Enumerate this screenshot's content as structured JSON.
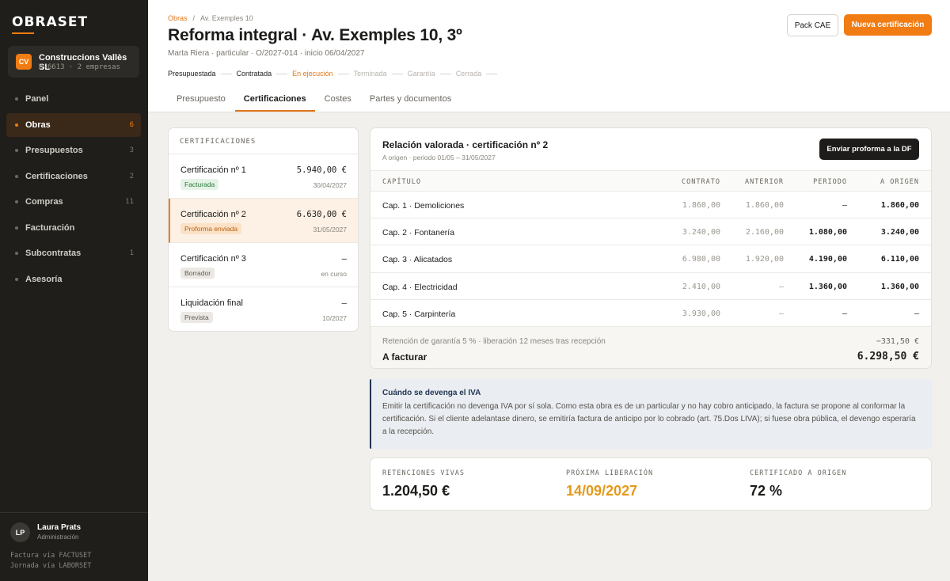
{
  "sidebar": {
    "logo": "OBRASET",
    "company": {
      "initials": "CV",
      "name": "Construccions Vallès SL",
      "sub": "B-6613 · 2 empresas"
    },
    "items": [
      {
        "label": "Panel",
        "count": ""
      },
      {
        "label": "Obras",
        "count": "6"
      },
      {
        "label": "Presupuestos",
        "count": "3"
      },
      {
        "label": "Certificaciones",
        "count": "2"
      },
      {
        "label": "Compras",
        "count": "11"
      },
      {
        "label": "Facturación",
        "count": ""
      },
      {
        "label": "Subcontratas",
        "count": "1"
      },
      {
        "label": "Asesoría",
        "count": ""
      }
    ],
    "user": {
      "initials": "LP",
      "name": "Laura Prats",
      "role": "Administración"
    },
    "footer": [
      "Factura vía FACTUSET",
      "Jornada vía LABORSET"
    ]
  },
  "header": {
    "breadcrumb": [
      "Obras",
      "Av. Exemples 10"
    ],
    "title": "Reforma integral · Av. Exemples 10, 3º",
    "subtitle": "Marta Riera · particular · O/2027-014 · inicio 06/04/2027",
    "stages": [
      "Presupuestada",
      "Contratada",
      "En ejecución",
      "Terminada",
      "Garantía",
      "Cerrada"
    ],
    "tabs": [
      "Presupuesto",
      "Certificaciones",
      "Costes",
      "Partes y documentos"
    ],
    "pack_label": "Pack CAE",
    "new_label": "Nueva certificación"
  },
  "certificaciones": {
    "heading": "CERTIFICACIONES",
    "items": [
      {
        "name": "Certificación nº 1",
        "amount": "5.940,00 €",
        "status": "Facturada",
        "date": "30/04/2027"
      },
      {
        "name": "Certificación nº 2",
        "amount": "6.630,00 €",
        "status": "Proforma enviada",
        "date": "31/05/2027"
      },
      {
        "name": "Certificación nº 3",
        "amount": "—",
        "status": "Borrador",
        "date": "en curso"
      },
      {
        "name": "Liquidación final",
        "amount": "—",
        "status": "Prevista",
        "date": "10/2027"
      }
    ]
  },
  "relacion": {
    "title": "Relación valorada · certificación nº 2",
    "subtitle": "A origen · periodo 01/05 – 31/05/2027",
    "send_label": "Enviar proforma a la DF",
    "columns": [
      "CAPÍTULO",
      "CONTRATO",
      "ANTERIOR",
      "PERIODO",
      "A ORIGEN"
    ],
    "rows": [
      {
        "cap": "Cap. 1 · Demoliciones",
        "contrato": "1.860,00",
        "anterior": "1.860,00",
        "periodo": "—",
        "origen": "1.860,00"
      },
      {
        "cap": "Cap. 2 · Fontanería",
        "contrato": "3.240,00",
        "anterior": "2.160,00",
        "periodo": "1.080,00",
        "origen": "3.240,00"
      },
      {
        "cap": "Cap. 3 · Alicatados",
        "contrato": "6.980,00",
        "anterior": "1.920,00",
        "periodo": "4.190,00",
        "origen": "6.110,00"
      },
      {
        "cap": "Cap. 4 · Electricidad",
        "contrato": "2.410,00",
        "anterior": "—",
        "periodo": "1.360,00",
        "origen": "1.360,00"
      },
      {
        "cap": "Cap. 5 · Carpintería",
        "contrato": "3.930,00",
        "anterior": "—",
        "periodo": "—",
        "origen": "—"
      }
    ],
    "retencion_label": "Retención de garantía 5 % · liberación 12 meses tras recepción",
    "retencion_value": "−331,50 €",
    "facturar_label": "A facturar",
    "facturar_value": "6.298,50 €"
  },
  "note": {
    "title": "Cuándo se devenga el IVA",
    "body": "Emitir la certificación no devenga IVA por sí sola. Como esta obra es de un particular y no hay cobro anticipado, la factura se propone al conformar la certificación. Si el cliente adelantase dinero, se emitiría factura de anticipo por lo cobrado (art. 75.Dos LIVA); si fuese obra pública, el devengo esperaría a la recepción."
  },
  "stats": [
    {
      "label": "RETENCIONES VIVAS",
      "value": "1.204,50 €"
    },
    {
      "label": "PRÓXIMA LIBERACIÓN",
      "value": "14/09/2027"
    },
    {
      "label": "CERTIFICADO A ORIGEN",
      "value": "72 %"
    }
  ],
  "colors": {
    "accent": "#f07c13",
    "sidebar": "#1f1e1b",
    "note_border": "#1f3552"
  }
}
